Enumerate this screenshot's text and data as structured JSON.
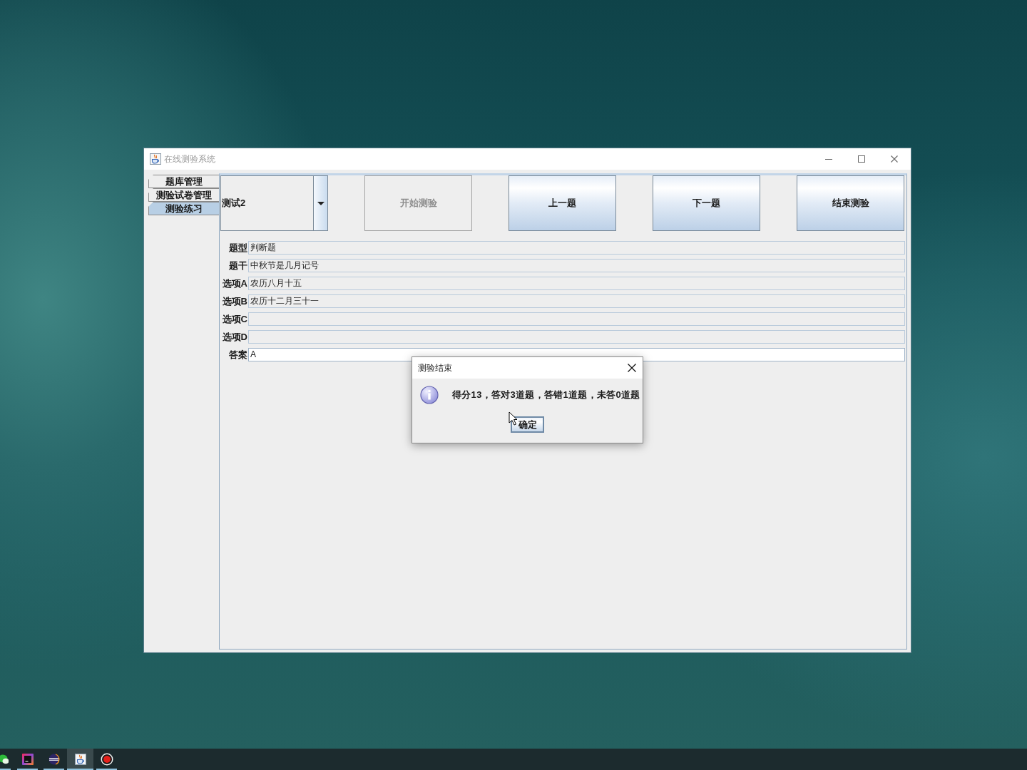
{
  "window": {
    "title": "在线测验系统"
  },
  "side_tabs": [
    {
      "label": "题库管理",
      "selected": false
    },
    {
      "label": "测验试卷管理",
      "selected": false
    },
    {
      "label": "测验练习",
      "selected": true
    }
  ],
  "toolbar": {
    "test_select": {
      "value": "测试2"
    },
    "buttons": [
      {
        "label": "开始测验",
        "disabled": true
      },
      {
        "label": "上一题",
        "disabled": false
      },
      {
        "label": "下一题",
        "disabled": false
      },
      {
        "label": "结束测验",
        "disabled": false
      }
    ]
  },
  "form": {
    "fields": [
      {
        "label": "题型",
        "value": "判断题",
        "editable": false
      },
      {
        "label": "题干",
        "value": "中秋节是几月记号",
        "editable": false
      },
      {
        "label": "选项A",
        "value": "农历八月十五",
        "editable": false
      },
      {
        "label": "选项B",
        "value": "农历十二月三十一",
        "editable": false
      },
      {
        "label": "选项C",
        "editable": false
      },
      {
        "label": "选项D",
        "editable": false
      },
      {
        "label": "答案",
        "value": "A",
        "editable": true
      }
    ]
  },
  "dialog": {
    "title": "测验结束",
    "message": "得分13，答对3道题，答错1道题，未答0道题",
    "buttons": [
      "确定"
    ]
  },
  "taskbar": {
    "apps": [
      {
        "kind": "chat",
        "active": false
      },
      {
        "kind": "ide",
        "active": false
      },
      {
        "kind": "sphere",
        "active": false
      },
      {
        "kind": "cup",
        "active": true
      },
      {
        "kind": "record",
        "active": false
      }
    ]
  }
}
